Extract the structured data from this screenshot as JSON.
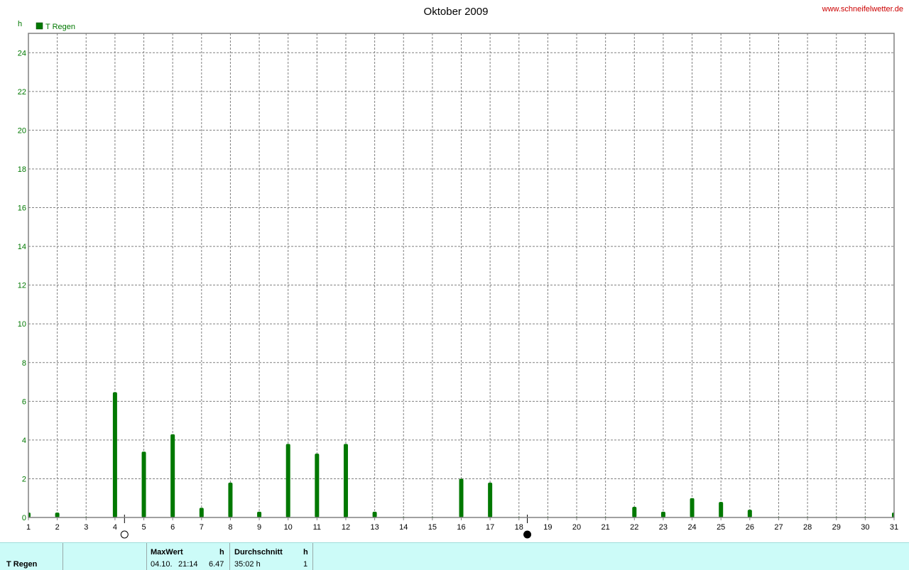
{
  "chart_data": {
    "type": "bar",
    "title": "Oktober 2009",
    "watermark": "www.schneifelwetter.de",
    "ylabel": "h",
    "ylim": [
      0,
      25
    ],
    "yticks": [
      0,
      2,
      4,
      6,
      8,
      10,
      12,
      14,
      16,
      18,
      20,
      22,
      24
    ],
    "xlim": [
      1,
      31
    ],
    "x": [
      1,
      2,
      3,
      4,
      5,
      6,
      7,
      8,
      9,
      10,
      11,
      12,
      13,
      14,
      15,
      16,
      17,
      18,
      19,
      20,
      21,
      22,
      23,
      24,
      25,
      26,
      27,
      28,
      29,
      30,
      31
    ],
    "grid": true,
    "legend_placement": "top-left",
    "series": [
      {
        "name": "T Regen",
        "color": "#007800",
        "values": [
          0.25,
          0.25,
          0,
          6.47,
          3.4,
          4.3,
          0.5,
          1.8,
          0.3,
          3.8,
          3.3,
          3.8,
          0.3,
          0,
          0,
          2.0,
          1.8,
          0,
          0,
          0,
          0,
          0.55,
          0.3,
          1.0,
          0.8,
          0.4,
          0,
          0,
          0,
          0,
          0.25
        ]
      }
    ],
    "moon_phases": [
      {
        "phase": "full-moon",
        "day": 4.33
      },
      {
        "phase": "new-moon",
        "day": 18.29
      }
    ],
    "colors": {
      "axis_text": "#007800",
      "grid": "#808080",
      "watermark": "#cc0000"
    }
  },
  "footer": {
    "series_name": "T Regen",
    "max_label": "MaxWert",
    "max_unit": "h",
    "max_date": "04.10.",
    "max_time": "21:14",
    "max_value": "6.47",
    "avg_label": "Durchschnitt",
    "avg_unit": "h",
    "avg_value": "35:02 h",
    "avg_count": "1"
  }
}
